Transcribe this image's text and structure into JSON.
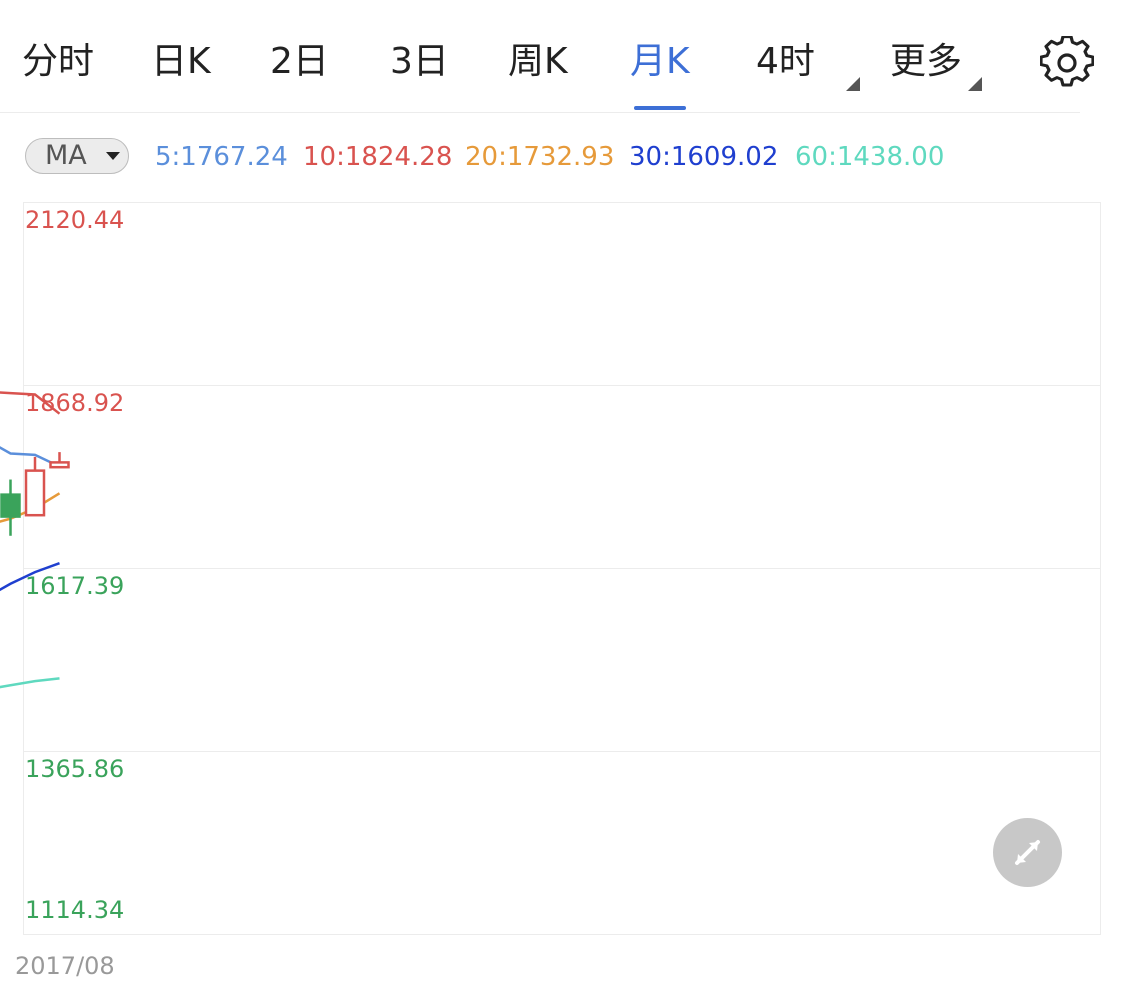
{
  "tabs": [
    {
      "label": "分时",
      "active": false
    },
    {
      "label": "日K",
      "active": false
    },
    {
      "label": "2日",
      "active": false
    },
    {
      "label": "3日",
      "active": false
    },
    {
      "label": "周K",
      "active": false
    },
    {
      "label": "月K",
      "active": true
    },
    {
      "label": "4时",
      "active": false,
      "has_dropdown": true
    },
    {
      "label": "更多",
      "active": false,
      "has_dropdown": true
    }
  ],
  "settings_icon": "gear-icon",
  "indicator": {
    "label": "MA",
    "values": [
      {
        "text": "5:1767.24",
        "color": "#5b8fdb"
      },
      {
        "text": "10:1824.28",
        "color": "#d9534f"
      },
      {
        "text": "20:1732.93",
        "color": "#e69a3a"
      },
      {
        "text": "30:1609.02",
        "color": "#1f3fcf"
      },
      {
        "text": "60:1438.00",
        "color": "#5fd9bf"
      }
    ]
  },
  "colors": {
    "accent": "#3d6fd6",
    "up": "#d9534f",
    "down": "#3aa35b",
    "grid": "#ececec"
  },
  "price_axis": [
    {
      "text": "2120.44",
      "color": "#d9534f"
    },
    {
      "text": "1868.92",
      "color": "#d9534f"
    },
    {
      "text": "1617.39",
      "color": "#3aa35b"
    },
    {
      "text": "1365.86",
      "color": "#3aa35b"
    },
    {
      "text": "1114.34",
      "color": "#3aa35b"
    }
  ],
  "date_axis": [
    "2017/08"
  ],
  "expand_icon": "expand-icon",
  "chart_data": {
    "type": "candlestick",
    "ylim": [
      1114.34,
      2120.44
    ],
    "candles": [
      {
        "open": 1720,
        "close": 1688,
        "high": 1742,
        "low": 1660,
        "direction": "down"
      },
      {
        "open": 1690,
        "close": 1755,
        "high": 1775,
        "low": 1690,
        "direction": "up"
      },
      {
        "open": 1760,
        "close": 1767,
        "high": 1782,
        "low": 1760,
        "direction": "up"
      }
    ],
    "series": [
      {
        "name": "5",
        "color": "#5b8fdb",
        "values": [
          1800,
          1780,
          1778,
          1761
        ]
      },
      {
        "name": "10",
        "color": "#d9534f",
        "values": [
          1870,
          1868,
          1866,
          1838
        ]
      },
      {
        "name": "20",
        "color": "#e69a3a",
        "values": [
          1675,
          1685,
          1700,
          1722
        ]
      },
      {
        "name": "30",
        "color": "#1f3fcf",
        "values": [
          1570,
          1590,
          1607,
          1620
        ]
      },
      {
        "name": "60",
        "color": "#5fd9bf",
        "values": [
          1436,
          1442,
          1448,
          1452
        ]
      }
    ]
  }
}
